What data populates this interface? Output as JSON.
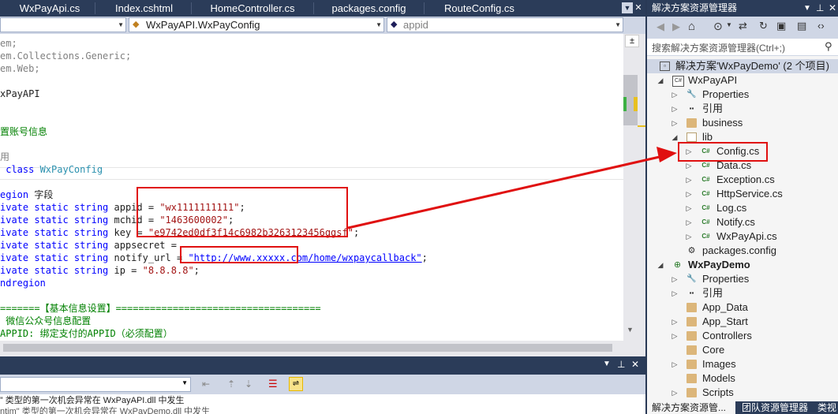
{
  "tabs": [
    {
      "label": "WxPayApi.cs"
    },
    {
      "label": "Index.cshtml"
    },
    {
      "label": "HomeController.cs"
    },
    {
      "label": "packages.config"
    },
    {
      "label": "RouteConfig.cs"
    }
  ],
  "navbar": {
    "project": "",
    "class": "WxPayAPI.WxPayConfig",
    "member": "appid"
  },
  "code_lines": [
    {
      "segments": [
        {
          "t": "em;",
          "c": "gray"
        }
      ]
    },
    {
      "segments": [
        {
          "t": "em.Collections.Generic;",
          "c": "gray"
        }
      ]
    },
    {
      "segments": [
        {
          "t": "em.Web;",
          "c": "gray"
        }
      ]
    },
    {
      "segments": [
        {
          "t": "",
          "c": ""
        }
      ]
    },
    {
      "segments": [
        {
          "t": "xPayAPI",
          "c": ""
        }
      ]
    },
    {
      "segments": [
        {
          "t": "",
          "c": ""
        }
      ]
    },
    {
      "segments": [
        {
          "t": "",
          "c": ""
        }
      ]
    },
    {
      "segments": [
        {
          "t": "置账号信息",
          "c": "cm"
        }
      ]
    },
    {
      "segments": [
        {
          "t": "",
          "c": ""
        }
      ]
    },
    {
      "segments": [
        {
          "t": "用",
          "c": "gray"
        }
      ]
    },
    {
      "segments": [
        {
          "t": " class ",
          "c": "kw"
        },
        {
          "t": "WxPayConfig",
          "c": "type"
        }
      ]
    },
    {
      "segments": [
        {
          "t": "",
          "c": ""
        }
      ]
    },
    {
      "segments": [
        {
          "t": "egion",
          "c": "kw"
        },
        {
          "t": " 字段",
          "c": ""
        }
      ]
    },
    {
      "segments": [
        {
          "t": "ivate static string",
          "c": "kw"
        },
        {
          "t": " appid = ",
          "c": ""
        },
        {
          "t": "\"wx1111111111\"",
          "c": "str"
        },
        {
          "t": ";",
          "c": ""
        }
      ]
    },
    {
      "segments": [
        {
          "t": "ivate static string",
          "c": "kw"
        },
        {
          "t": " mchid = ",
          "c": ""
        },
        {
          "t": "\"1463600002\"",
          "c": "str"
        },
        {
          "t": ";",
          "c": ""
        }
      ]
    },
    {
      "segments": [
        {
          "t": "ivate static string",
          "c": "kw"
        },
        {
          "t": " key = ",
          "c": ""
        },
        {
          "t": "\"e9742ed0df3f14c6982b3263123456ggsf\"",
          "c": "str"
        },
        {
          "t": ";",
          "c": ""
        }
      ]
    },
    {
      "segments": [
        {
          "t": "ivate static string",
          "c": "kw"
        },
        {
          "t": " appsecret = ",
          "c": ""
        }
      ]
    },
    {
      "segments": [
        {
          "t": "ivate static string",
          "c": "kw"
        },
        {
          "t": " notify_url = ",
          "c": ""
        },
        {
          "t": "\"http://www.xxxxx.com/home/wxpaycallback\"",
          "c": "str"
        },
        {
          "t": ";",
          "c": ""
        }
      ]
    },
    {
      "segments": [
        {
          "t": "ivate static string",
          "c": "kw"
        },
        {
          "t": " ip = ",
          "c": ""
        },
        {
          "t": "\"8.8.8.8\"",
          "c": "str"
        },
        {
          "t": ";",
          "c": ""
        }
      ]
    },
    {
      "segments": [
        {
          "t": "ndregion",
          "c": "kw"
        }
      ]
    },
    {
      "segments": [
        {
          "t": "",
          "c": ""
        }
      ]
    },
    {
      "segments": [
        {
          "t": "=======【基本信息设置】====================================",
          "c": "cm"
        }
      ]
    },
    {
      "segments": [
        {
          "t": " 微信公众号信息配置",
          "c": "cm"
        }
      ]
    },
    {
      "segments": [
        {
          "t": "APPID: 绑定支付的APPID（必须配置）",
          "c": "cm"
        }
      ]
    }
  ],
  "output": {
    "lines": [
      "” 类型的第一次机会异常在 WxPayAPI.dll 中发生"
    ]
  },
  "solution_explorer": {
    "title": "解决方案资源管理器",
    "search_placeholder": "搜索解决方案资源管理器(Ctrl+;)",
    "solution_label": "解决方案'WxPayDemo' (2 个项目)",
    "tree": [
      {
        "label": "WxPayAPI",
        "icon": "csharp-project-icon",
        "level": 1,
        "exp": "open"
      },
      {
        "label": "Properties",
        "icon": "wrench-icon",
        "level": 2,
        "exp": "closed"
      },
      {
        "label": "引用",
        "icon": "references-icon",
        "level": 2,
        "exp": "closed"
      },
      {
        "label": "business",
        "icon": "folder-icon",
        "level": 2,
        "exp": "closed"
      },
      {
        "label": "lib",
        "icon": "folder-open-icon",
        "level": 2,
        "exp": "open"
      },
      {
        "label": "Config.cs",
        "icon": "csharp-file-icon",
        "level": 3,
        "exp": "closed"
      },
      {
        "label": "Data.cs",
        "icon": "csharp-file-icon",
        "level": 3,
        "exp": "closed"
      },
      {
        "label": "Exception.cs",
        "icon": "csharp-file-icon",
        "level": 3,
        "exp": "closed"
      },
      {
        "label": "HttpService.cs",
        "icon": "csharp-file-icon",
        "level": 3,
        "exp": "closed"
      },
      {
        "label": "Log.cs",
        "icon": "csharp-file-icon",
        "level": 3,
        "exp": "closed"
      },
      {
        "label": "Notify.cs",
        "icon": "csharp-file-icon",
        "level": 3,
        "exp": "closed"
      },
      {
        "label": "WxPayApi.cs",
        "icon": "csharp-file-icon",
        "level": 3,
        "exp": "closed"
      },
      {
        "label": "packages.config",
        "icon": "config-file-icon",
        "level": 2,
        "exp": "none"
      },
      {
        "label": "WxPayDemo",
        "icon": "web-project-icon",
        "level": 1,
        "exp": "open",
        "bold": true
      },
      {
        "label": "Properties",
        "icon": "wrench-icon",
        "level": 2,
        "exp": "closed"
      },
      {
        "label": "引用",
        "icon": "references-icon",
        "level": 2,
        "exp": "closed"
      },
      {
        "label": "App_Data",
        "icon": "folder-icon",
        "level": 2,
        "exp": "none"
      },
      {
        "label": "App_Start",
        "icon": "folder-icon",
        "level": 2,
        "exp": "closed"
      },
      {
        "label": "Controllers",
        "icon": "folder-icon",
        "level": 2,
        "exp": "closed"
      },
      {
        "label": "Core",
        "icon": "folder-icon",
        "level": 2,
        "exp": "none"
      },
      {
        "label": "Images",
        "icon": "folder-icon",
        "level": 2,
        "exp": "closed"
      },
      {
        "label": "Models",
        "icon": "folder-icon",
        "level": 2,
        "exp": "none"
      },
      {
        "label": "Scripts",
        "icon": "folder-icon",
        "level": 2,
        "exp": "closed"
      }
    ],
    "bottom_tabs": [
      "解决方案资源管...",
      "团队资源管理器",
      "类视"
    ]
  },
  "colors": {
    "vs_dark_blue": "#2b3c59",
    "annotation_red": "#e01010"
  }
}
